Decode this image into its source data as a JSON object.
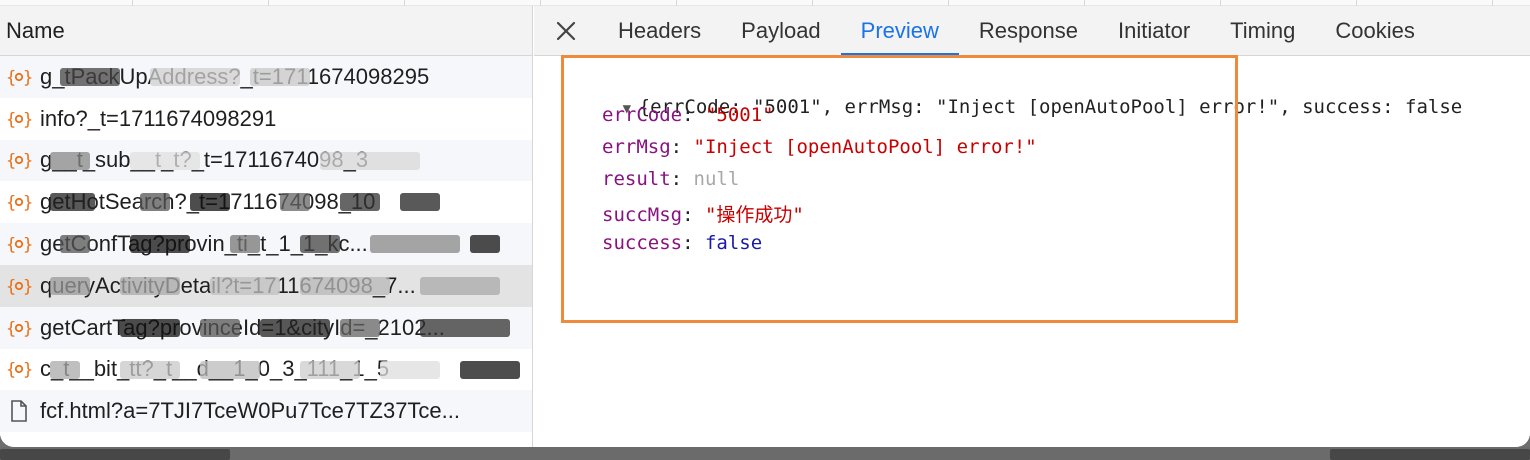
{
  "list": {
    "header": "Name",
    "rows": [
      {
        "text": "g_tPackUpAddress?_t=1711674098295",
        "icon": "xhr-icon",
        "state": "alt"
      },
      {
        "text": "info?_t=1711674098291",
        "icon": "xhr-icon",
        "state": ""
      },
      {
        "text": "g__t_sub__t_t?_t=1711674098_3",
        "icon": "xhr-icon",
        "state": "alt"
      },
      {
        "text": "getHotSearch?_t=1711674098_10",
        "icon": "xhr-icon",
        "state": ""
      },
      {
        "text": "getConfTag?provin_ti_t_1_1_kc...",
        "icon": "xhr-icon",
        "state": "alt"
      },
      {
        "text": "queryActivityDetail?t=1711674098_7...",
        "icon": "xhr-icon",
        "state": "selected"
      },
      {
        "text": "getCartTag?provinceId=1&cityId=_2102...",
        "icon": "xhr-icon",
        "state": "alt"
      },
      {
        "text": "c_t__bit_tt?_t__d__1_0_3_111_1_5",
        "icon": "xhr-icon",
        "state": ""
      },
      {
        "text": "fcf.html?a=7TJI7TceW0Pu7Tce7TZ37Tce...",
        "icon": "document-icon",
        "state": "alt"
      }
    ]
  },
  "tabs": {
    "close_label": "✕",
    "items": [
      {
        "label": "Headers",
        "active": false
      },
      {
        "label": "Payload",
        "active": false
      },
      {
        "label": "Preview",
        "active": true
      },
      {
        "label": "Response",
        "active": false
      },
      {
        "label": "Initiator",
        "active": false
      },
      {
        "label": "Timing",
        "active": false
      },
      {
        "label": "Cookies",
        "active": false
      }
    ]
  },
  "preview": {
    "summary": "{errCode: \"5001\", errMsg: \"Inject [openAutoPool] error!\", success: false",
    "fields": [
      {
        "key": "errCode",
        "value": "\"5001\"",
        "type": "string"
      },
      {
        "key": "errMsg",
        "value": "\"Inject [openAutoPool] error!\"",
        "type": "string"
      },
      {
        "key": "result",
        "value": "null",
        "type": "null"
      },
      {
        "key": "succMsg",
        "value": "\"操作成功\"",
        "type": "string"
      },
      {
        "key": "success",
        "value": "false",
        "type": "bool"
      }
    ]
  },
  "colors": {
    "accent": "#1a73e8",
    "highlight": "#ef8a3c",
    "key": "#881280",
    "string": "#c80000",
    "xhr_icon": "#e8711a"
  }
}
